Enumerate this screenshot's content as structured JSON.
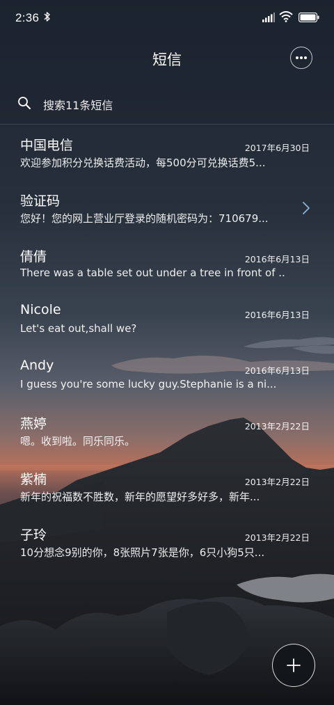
{
  "status_bar": {
    "time": "2:36"
  },
  "header": {
    "title": "短信"
  },
  "search": {
    "placeholder": "搜索11条短信"
  },
  "conversations": [
    {
      "name": "中国电信",
      "date": "2017年6月30日",
      "preview": "欢迎参加积分兑换话费活动，每500分可兑换话费5..."
    },
    {
      "name": "验证码",
      "date": "",
      "preview": "您好！您的网上营业厅登录的随机密码为：710679..."
    },
    {
      "name": "倩倩",
      "date": "2016年6月13日",
      "preview": "There was a table set out under a tree in front of ..."
    },
    {
      "name": "Nicole",
      "date": "2016年6月13日",
      "preview": "Let's eat out,shall we?"
    },
    {
      "name": "Andy",
      "date": "2016年6月13日",
      "preview": "I guess you're some lucky guy.Stephanie is a ni..."
    },
    {
      "name": "燕婷",
      "date": "2013年2月22日",
      "preview": "嗯。收到啦。同乐同乐。"
    },
    {
      "name": "紫楠",
      "date": "2013年2月22日",
      "preview": "新年的祝福数不胜数，新年的愿望好多好多，新年..."
    },
    {
      "name": "子玲",
      "date": "2013年2月22日",
      "preview": "10分想念9别的你，8张照片7张是你，6只小狗5只..."
    }
  ],
  "icons": {
    "status": [
      "bluetooth-icon",
      "signal-icon",
      "wifi-icon",
      "battery-icon"
    ],
    "header": "more-icon",
    "search": "search-icon",
    "folder": "chevron-right-icon",
    "compose": "plus-icon"
  },
  "colors": {
    "text": "#ffffff",
    "sky_top": "#1d2530",
    "sunset": "#c46e55"
  }
}
